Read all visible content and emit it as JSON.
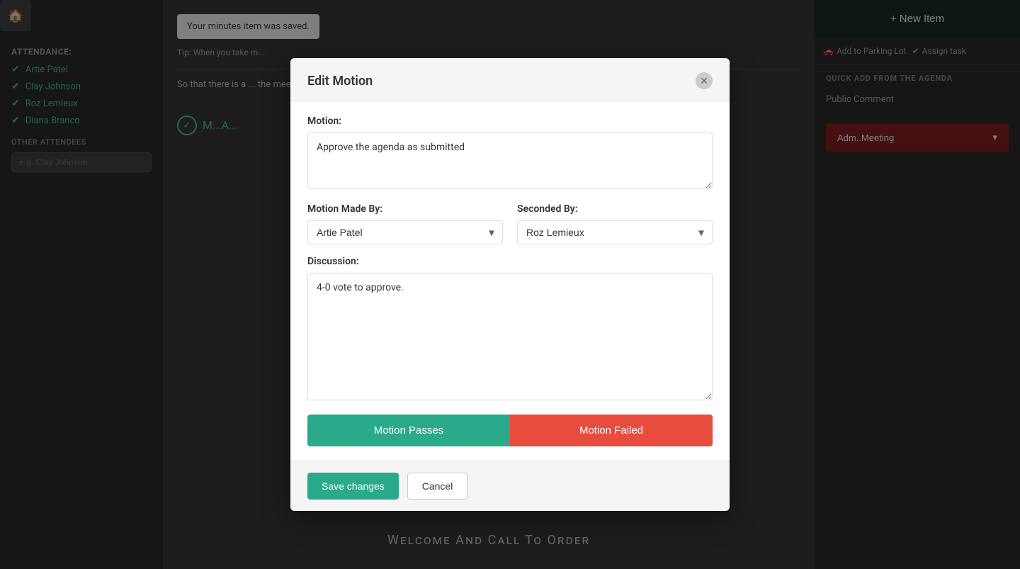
{
  "sidebar": {
    "attendance_title": "Attendance:",
    "attendees": [
      {
        "name": "Artie Patel"
      },
      {
        "name": "Clay Johnson"
      },
      {
        "name": "Roz Lemieux"
      },
      {
        "name": "Diana Branco"
      }
    ],
    "other_attendees_title": "Other Attendees",
    "other_attendees_placeholder": "e.g. Clay Johnson"
  },
  "main": {
    "saved_banner": "Your minutes item was saved.",
    "tip_text": "Tip: When you take m...",
    "content_text": "So that there is a ... the meeting, the... stick to that age...",
    "footer_title": "Welcome And Call To Order"
  },
  "right_sidebar": {
    "new_item_label": "+ New Item",
    "parking_lot_label": "Add to Parking Lot",
    "assign_task_label": "Assign task",
    "quick_add_title": "Quick Add From The Agenda",
    "quick_add_item": "Public Comment",
    "admin_btn_label": "Adm..Meeting"
  },
  "modal": {
    "title": "Edit Motion",
    "motion_label": "Motion:",
    "motion_value": "Approve the agenda as submitted",
    "motion_made_by_label": "Motion Made By:",
    "motion_made_by_value": "Artie Patel",
    "motion_made_by_options": [
      "Artie Patel",
      "Clay Johnson",
      "Roz Lemieux",
      "Diana Branco"
    ],
    "seconded_by_label": "Seconded By:",
    "seconded_by_value": "Roz Lemieux",
    "seconded_by_options": [
      "Artie Patel",
      "Clay Johnson",
      "Roz Lemieux",
      "Diana Branco"
    ],
    "discussion_label": "Discussion:",
    "discussion_value": "4-0 vote to approve.",
    "motion_passes_label": "Motion Passes",
    "motion_failed_label": "Motion Failed",
    "save_label": "Save changes",
    "cancel_label": "Cancel"
  }
}
